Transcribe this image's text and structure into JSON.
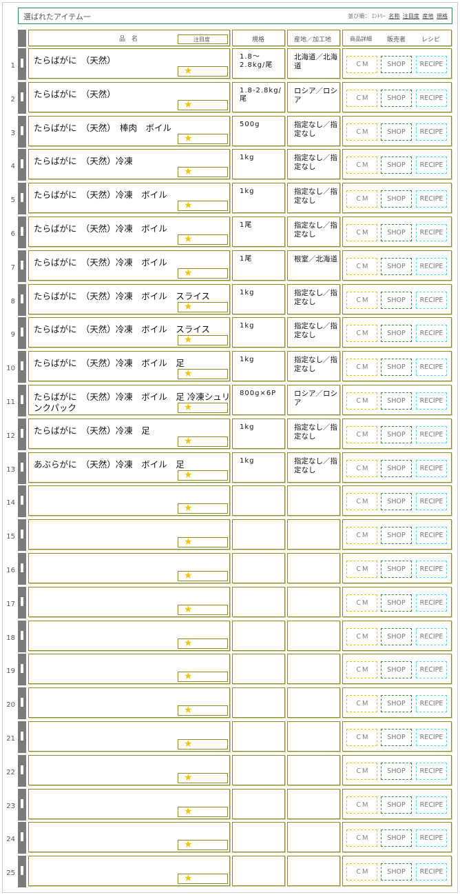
{
  "topbar": {
    "title": "選ばれたアイテム一",
    "sort_label": "並び順：",
    "sort_entry": "ｴﾝﾄﾘｰ",
    "sort_links": [
      "名称",
      "注目度",
      "産地",
      "規格"
    ]
  },
  "header": {
    "name": "品　名",
    "attention": "注目度",
    "spec": "規格",
    "origin": "産地／加工地",
    "detail": "商品詳細",
    "seller": "販売者",
    "recipe": "レシピ"
  },
  "buttons": {
    "cm": "ＣＭ",
    "shop": "SHOP",
    "recipe": "RECIPE"
  },
  "rating_icon": "★",
  "colors": {
    "frame": "#8b8b2e",
    "topbar_border": "#2e8b57",
    "grip": "#7b7b7b",
    "star": "#f2c40e",
    "cm": "#d3c400",
    "shop": "#2e8b2e",
    "recipe": "#48d6e8"
  },
  "rows": [
    {
      "num": "1",
      "name": "たらばがに　（天然）",
      "spec": "1.8～2.8kg/尾",
      "origin": "北海道／北海道"
    },
    {
      "num": "2",
      "name": "たらばがに　（天然）",
      "spec": "1.8‐2.8kg/尾",
      "origin": "ロシア／ロシア"
    },
    {
      "num": "3",
      "name": "たらばがに　（天然）　棒肉　ボイル",
      "spec": "500g",
      "origin": "指定なし／指定なし"
    },
    {
      "num": "4",
      "name": "たらばがに　（天然）冷凍",
      "spec": "1kg",
      "origin": "指定なし／指定なし"
    },
    {
      "num": "5",
      "name": "たらばがに　（天然）冷凍　ボイル",
      "spec": "1kg",
      "origin": "指定なし／指定なし"
    },
    {
      "num": "6",
      "name": "たらばがに　（天然）冷凍　ボイル",
      "spec": "1尾",
      "origin": "指定なし／指定なし"
    },
    {
      "num": "7",
      "name": "たらばがに　（天然）冷凍　ボイル",
      "spec": "1尾",
      "origin": "根室／北海道"
    },
    {
      "num": "8",
      "name": "たらばがに　（天然）冷凍　ボイル　スライス",
      "spec": "1kg",
      "origin": "指定なし／指定なし"
    },
    {
      "num": "9",
      "name": "たらばがに　（天然）冷凍　ボイル　スライス",
      "spec": "1kg",
      "origin": "指定なし／指定なし"
    },
    {
      "num": "10",
      "name": "たらばがに　（天然）冷凍　ボイル　足",
      "spec": "1kg",
      "origin": "指定なし／指定なし"
    },
    {
      "num": "11",
      "name": "たらばがに　（天然）冷凍　ボイル　足 冷凍シュリンクパック",
      "spec": "800g×6P",
      "origin": "ロシア／ロシア"
    },
    {
      "num": "12",
      "name": "たらばがに　（天然）冷凍　足",
      "spec": "1kg",
      "origin": "指定なし／指定なし"
    },
    {
      "num": "13",
      "name": "あぶらがに　（天然）冷凍　ボイル　足",
      "spec": "1kg",
      "origin": "指定なし／指定なし"
    },
    {
      "num": "14",
      "name": "",
      "spec": "",
      "origin": ""
    },
    {
      "num": "15",
      "name": "",
      "spec": "",
      "origin": ""
    },
    {
      "num": "16",
      "name": "",
      "spec": "",
      "origin": ""
    },
    {
      "num": "17",
      "name": "",
      "spec": "",
      "origin": ""
    },
    {
      "num": "18",
      "name": "",
      "spec": "",
      "origin": ""
    },
    {
      "num": "19",
      "name": "",
      "spec": "",
      "origin": ""
    },
    {
      "num": "20",
      "name": "",
      "spec": "",
      "origin": ""
    },
    {
      "num": "21",
      "name": "",
      "spec": "",
      "origin": ""
    },
    {
      "num": "22",
      "name": "",
      "spec": "",
      "origin": ""
    },
    {
      "num": "23",
      "name": "",
      "spec": "",
      "origin": ""
    },
    {
      "num": "24",
      "name": "",
      "spec": "",
      "origin": ""
    },
    {
      "num": "25",
      "name": "",
      "spec": "",
      "origin": ""
    }
  ]
}
